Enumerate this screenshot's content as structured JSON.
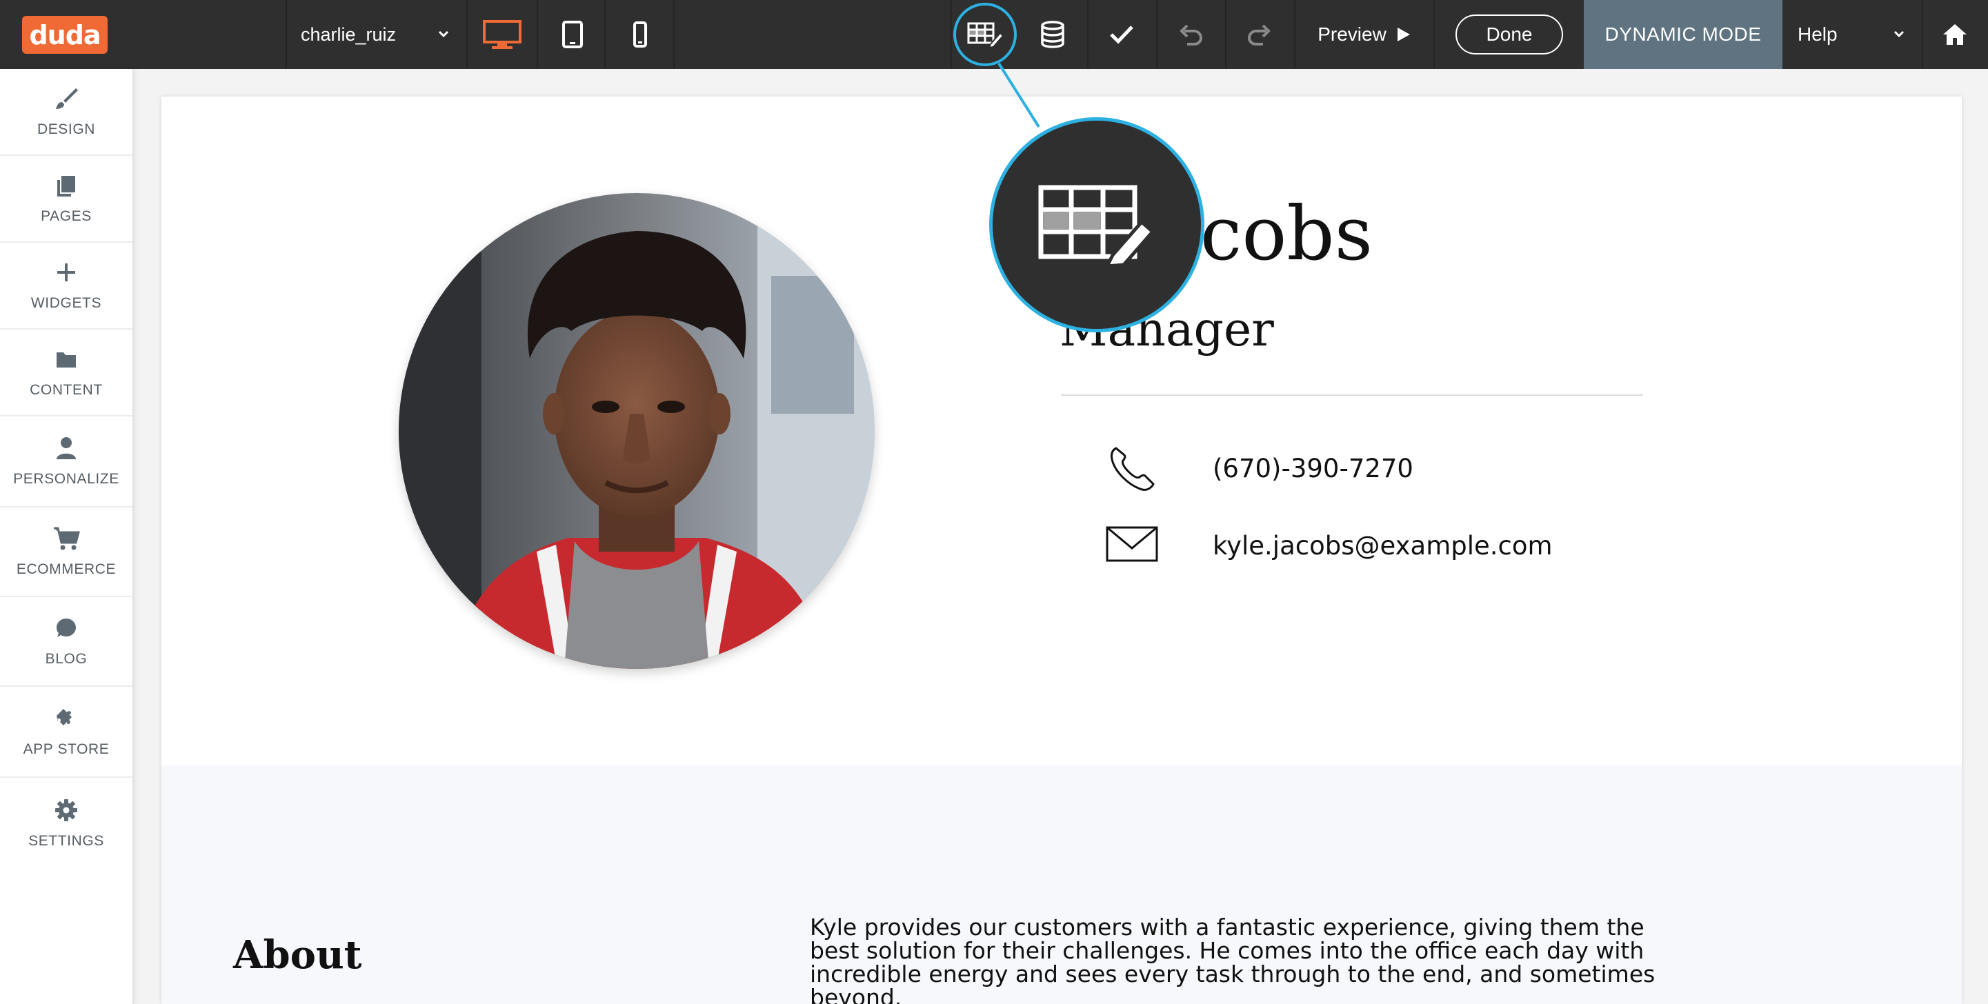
{
  "app": {
    "logo_text": "duda",
    "brand_color": "#f06a35",
    "accent_color": "#2cb1e2"
  },
  "toolbar": {
    "site_name": "charlie_ruiz",
    "devices": [
      "desktop-icon",
      "tablet-icon",
      "mobile-icon"
    ],
    "active_device": "desktop",
    "actions": [
      "collection-edit-icon",
      "database-icon",
      "checkmark-icon",
      "undo-icon",
      "redo-icon"
    ],
    "preview_label": "Preview",
    "done_label": "Done",
    "dynamic_mode_label": "DYNAMIC MODE",
    "help_label": "Help"
  },
  "sidebar": {
    "items": [
      {
        "label": "DESIGN",
        "icon": "brush-icon"
      },
      {
        "label": "PAGES",
        "icon": "pages-icon"
      },
      {
        "label": "WIDGETS",
        "icon": "plus-icon"
      },
      {
        "label": "CONTENT",
        "icon": "folder-icon"
      },
      {
        "label": "PERSONALIZE",
        "icon": "person-icon"
      },
      {
        "label": "ECOMMERCE",
        "icon": "cart-icon"
      },
      {
        "label": "BLOG",
        "icon": "chat-bubble-icon"
      },
      {
        "label": "APP STORE",
        "icon": "puzzle-icon"
      },
      {
        "label": "SETTINGS",
        "icon": "gear-icon"
      }
    ]
  },
  "page": {
    "name_visible": "e Jacobs",
    "role_visible": "Manager",
    "phone": "(670)-390-7270",
    "email": "kyle.jacobs@example.com",
    "about_title": "About",
    "about_lines": [
      "Kyle provides our customers with a fantastic experience, giving them the",
      "best solution for their challenges. He comes into the office each day with",
      "incredible energy and sees every task through to the end, and sometimes",
      "beyond."
    ]
  }
}
